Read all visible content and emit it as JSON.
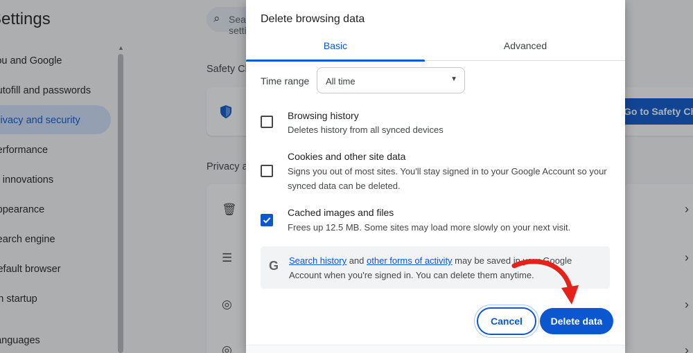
{
  "background": {
    "title": "Settings",
    "search_placeholder": "Search settings",
    "sidebar": [
      {
        "label": "You and Google"
      },
      {
        "label": "Autofill and passwords"
      },
      {
        "label": "Privacy and security"
      },
      {
        "label": "Performance"
      },
      {
        "label": "AI innovations"
      },
      {
        "label": "Appearance"
      },
      {
        "label": "Search engine"
      },
      {
        "label": "Default browser"
      },
      {
        "label": "On startup"
      },
      {
        "label": "Languages"
      }
    ],
    "safety_heading": "Safety Check",
    "safety_button": "Go to Safety Check",
    "privacy_heading": "Privacy and security"
  },
  "dialog": {
    "title": "Delete browsing data",
    "tabs": [
      {
        "label": "Basic",
        "active": true
      },
      {
        "label": "Advanced",
        "active": false
      }
    ],
    "time_range_label": "Time range",
    "time_range_value": "All time",
    "options": [
      {
        "title": "Browsing history",
        "description": "Deletes history from all synced devices",
        "checked": false
      },
      {
        "title": "Cookies and other site data",
        "description": "Signs you out of most sites. You'll stay signed in to your Google Account so your synced data can be deleted.",
        "checked": false
      },
      {
        "title": "Cached images and files",
        "description": "Frees up 12.5 MB. Some sites may load more slowly on your next visit.",
        "checked": true
      }
    ],
    "note": {
      "link1": "Search history",
      "mid1": " and ",
      "link2": "other forms of activity",
      "rest": " may be saved in your Google Account when you're signed in. You can delete them anytime."
    },
    "cancel_label": "Cancel",
    "delete_label": "Delete data"
  },
  "colors": {
    "accent": "#0b57d0",
    "annotation_arrow": "#e8201a"
  }
}
